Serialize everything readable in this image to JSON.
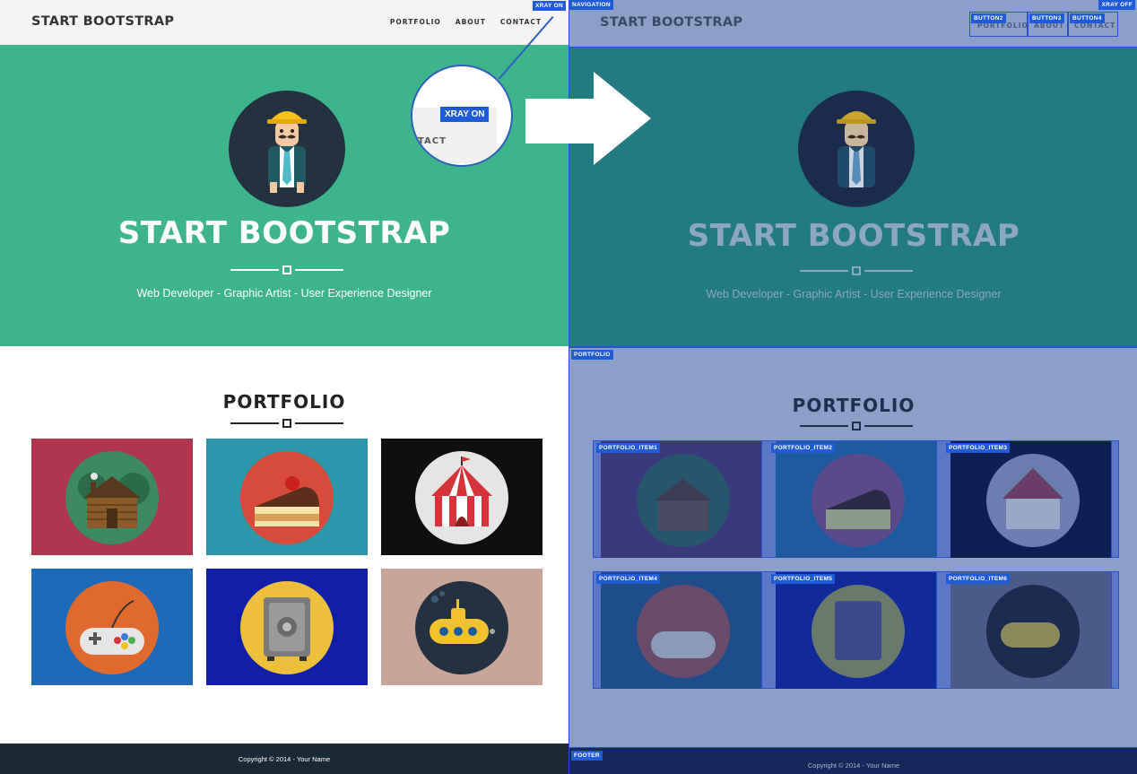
{
  "brand": "START BOOTSTRAP",
  "nav": {
    "links": [
      "PORTFOLIO",
      "ABOUT",
      "CONTACT"
    ]
  },
  "hero": {
    "title": "START BOOTSTRAP",
    "subtitle": "Web Developer - Graphic Artist - User Experience Designer"
  },
  "portfolio": {
    "heading": "PORTFOLIO",
    "items": [
      {
        "icon": "cabin-icon",
        "bg": "#b0354f"
      },
      {
        "icon": "cake-icon",
        "bg": "#2c97ab"
      },
      {
        "icon": "circus-tent-icon",
        "bg": "#0f0f0f"
      },
      {
        "icon": "game-controller-icon",
        "bg": "#1e6ab8"
      },
      {
        "icon": "safe-icon",
        "bg": "#111fa8"
      },
      {
        "icon": "submarine-icon",
        "bg": "#c9a599"
      }
    ]
  },
  "footer": {
    "copyright": "Copyright © 2014 - Your Name"
  },
  "xray": {
    "on_label": "XRAY ON",
    "off_label": "XRAY OFF",
    "magnifier_badge": "XRAY ON",
    "magnifier_text": "TACT",
    "tags": {
      "navigation": "NAVIGATION",
      "portfolio": "PORTFOLIO",
      "footer": "FOOTER",
      "button2": "BUTTON2",
      "button3": "BUTTON3",
      "button4": "BUTTON4",
      "items": [
        "PORTFOLIO_ITEM1",
        "PORTFOLIO_ITEM2",
        "PORTFOLIO_ITEM3",
        "PORTFOLIO_ITEM4",
        "PORTFOLIO_ITEM5",
        "PORTFOLIO_ITEM6"
      ]
    }
  },
  "colors": {
    "hero": "#3db48b",
    "footer": "#1b2836",
    "xray_blue": "#1f5bd6",
    "xray_overlay": "#8aa0c6"
  }
}
